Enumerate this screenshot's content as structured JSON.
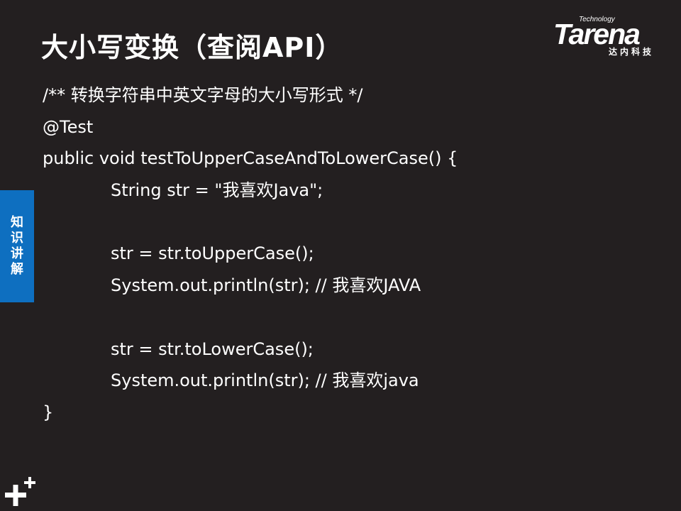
{
  "slide": {
    "title": "大小写变换（查阅API）"
  },
  "logo": {
    "technology": "Technology",
    "wordmark": "Tarena",
    "chinese": "达内科技"
  },
  "side_tab": {
    "chars": [
      "知",
      "识",
      "讲",
      "解"
    ]
  },
  "code": {
    "lines": [
      "/** 转换字符串中英文字母的大小写形式 */",
      "@Test",
      "public void testToUpperCaseAndToLowerCase() {",
      "String str = \"我喜欢Java\";",
      "",
      "str = str.toUpperCase();",
      "System.out.println(str); // 我喜欢JAVA",
      "",
      "str = str.toLowerCase();",
      "System.out.println(str); // 我喜欢java",
      "}"
    ]
  },
  "colors": {
    "background": "#231f20",
    "accent": "#0e6fc0",
    "text": "#ffffff"
  },
  "icons": {
    "corner": "plus-plus-icon"
  }
}
